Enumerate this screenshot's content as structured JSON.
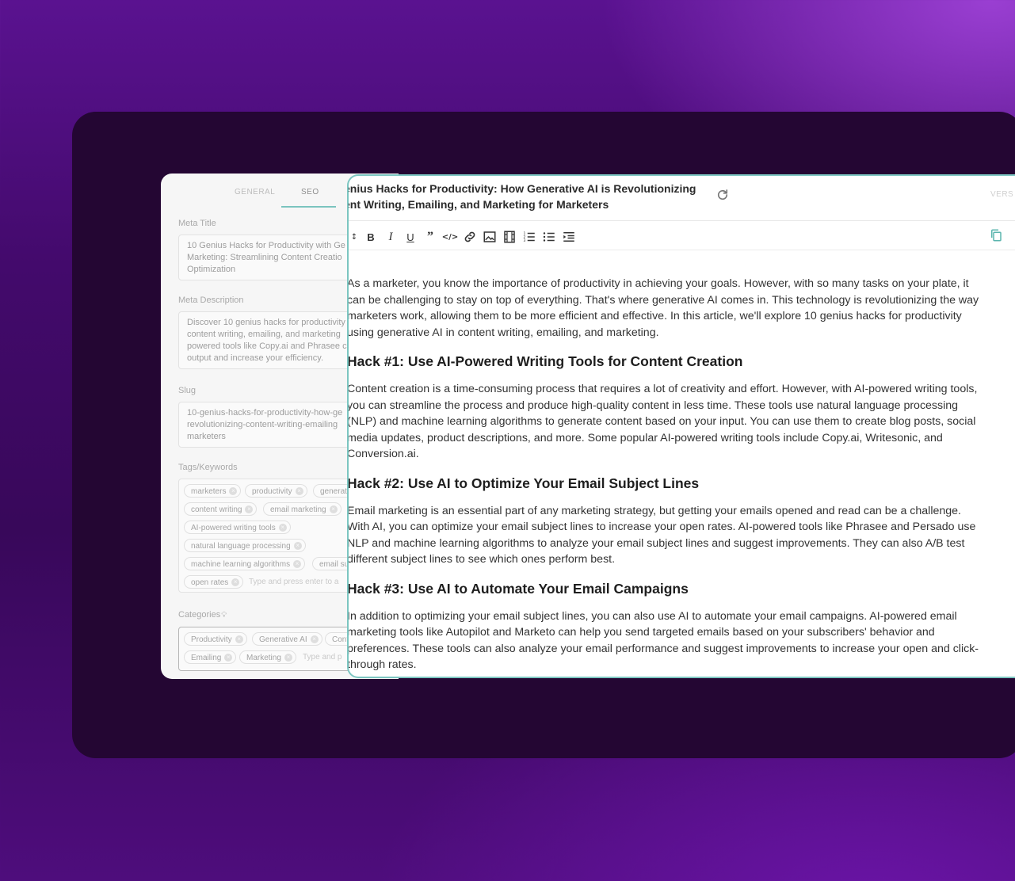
{
  "seo_panel": {
    "tabs": [
      "GENERAL",
      "SEO"
    ],
    "active_tab": "SEO",
    "meta_title_label": "Meta Title",
    "meta_title_value": "10 Genius Hacks for Productivity with Ge\nMarketing: Streamlining Content Creatio\nOptimization",
    "meta_description_label": "Meta Description",
    "meta_description_value": "Discover 10 genius hacks for productivity\ncontent writing, emailing, and marketing\npowered tools like Copy.ai and Phrasee c\noutput and increase your efficiency.",
    "slug_label": "Slug",
    "slug_value": "10-genius-hacks-for-productivity-how-ge\nrevolutionizing-content-writing-emailing\nmarketers",
    "tags_label": "Tags/Keywords",
    "tags": [
      "marketers",
      "productivity",
      "generat",
      "content writing",
      "email marketing",
      "AI-powered writing tools",
      "natural language processing",
      "machine learning algorithms",
      "email su",
      "open rates"
    ],
    "tags_placeholder": "Type and press enter to a",
    "categories_label": "Categories",
    "categories": [
      "Productivity",
      "Generative AI",
      "Cont",
      "Emailing",
      "Marketing"
    ],
    "categories_placeholder": "Type and p"
  },
  "editor": {
    "title": "enius Hacks for Productivity: How Generative AI is Revolutionizing\nent Writing, Emailing, and Marketing for Marketers",
    "version_label": "VERS",
    "toolbar": [
      "sort-icon",
      "bold-icon",
      "italic-icon",
      "underline-icon",
      "quote-icon",
      "code-icon",
      "link-icon",
      "image-icon",
      "video-icon",
      "ordered-list-icon",
      "bullet-list-icon",
      "indent-icon"
    ],
    "paragraph_intro": "As a marketer, you know the importance of productivity in achieving your goals. However, with so many tasks on your plate, it can be challenging to stay on top of everything. That's where generative AI comes in. This technology is revolutionizing the way marketers work, allowing them to be more efficient and effective. In this article, we'll explore 10 genius hacks for productivity using generative AI in content writing, emailing, and marketing.",
    "heading_1": "Hack #1: Use AI-Powered Writing Tools for Content Creation",
    "paragraph_1": "Content creation is a time-consuming process that requires a lot of creativity and effort. However, with AI-powered writing tools, you can streamline the process and produce high-quality content in less time. These tools use natural language processing (NLP) and machine learning algorithms to generate content based on your input. You can use them to create blog posts, social media updates, product descriptions, and more. Some popular AI-powered writing tools include Copy.ai, Writesonic, and Conversion.ai.",
    "heading_2": "Hack #2: Use AI to Optimize Your Email Subject Lines",
    "paragraph_2": "Email marketing is an essential part of any marketing strategy, but getting your emails opened and read can be a challenge. With AI, you can optimize your email subject lines to increase your open rates. AI-powered tools like Phrasee and Persado use NLP and machine learning algorithms to analyze your email subject lines and suggest improvements. They can also A/B test different subject lines to see which ones perform best.",
    "heading_3": "Hack #3: Use AI to Automate Your Email Campaigns",
    "paragraph_3": "In addition to optimizing your email subject lines, you can also use AI to automate your email campaigns. AI-powered email marketing tools like Autopilot and Marketo can help you send targeted emails based on your subscribers' behavior and preferences. These tools can also analyze your email performance and suggest improvements to increase your open and click-through rates."
  }
}
